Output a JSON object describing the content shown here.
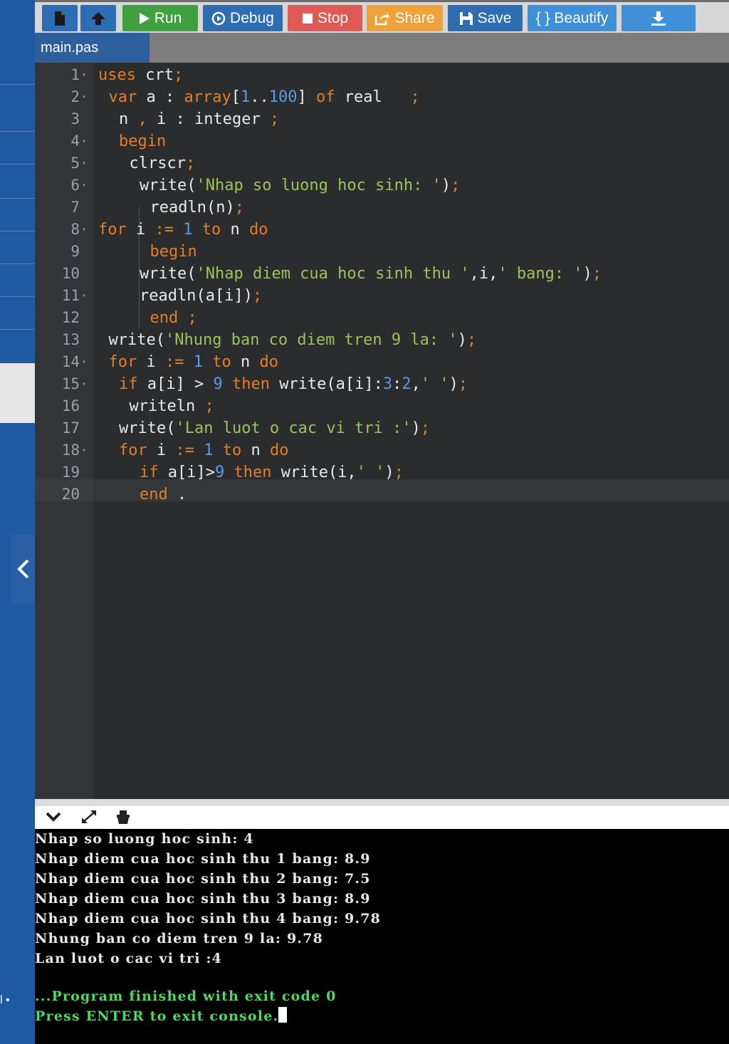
{
  "toolbar": {
    "buttons": [
      {
        "label": "",
        "icon": "new-file-icon",
        "color": "#2c6db5"
      },
      {
        "label": "",
        "icon": "upload-icon",
        "color": "#2c6db5"
      },
      {
        "label": "Run",
        "icon": "play-icon",
        "color": "#3fa03f"
      },
      {
        "label": "Debug",
        "icon": "debug-icon",
        "color": "#2f6db3"
      },
      {
        "label": "Stop",
        "icon": "stop-icon",
        "color": "#e05a55"
      },
      {
        "label": "Share",
        "icon": "share-icon",
        "color": "#f0a23a"
      },
      {
        "label": "Save",
        "icon": "save-icon",
        "color": "#2f6db3"
      },
      {
        "label": "{ } Beautify",
        "icon": "",
        "color": "#3f8fd9"
      },
      {
        "label": "",
        "icon": "download-icon",
        "color": "#3f8fd9"
      }
    ]
  },
  "tab": {
    "filename": "main.pas"
  },
  "editor": {
    "active_line": 17,
    "lines": [
      {
        "n": "1",
        "fold": true
      },
      {
        "n": "2",
        "fold": true
      },
      {
        "n": "3",
        "fold": false
      },
      {
        "n": "4",
        "fold": true
      },
      {
        "n": "5",
        "fold": true
      },
      {
        "n": "6",
        "fold": true
      },
      {
        "n": "7",
        "fold": false
      },
      {
        "n": "8",
        "fold": true
      },
      {
        "n": "9",
        "fold": false
      },
      {
        "n": "10",
        "fold": false
      },
      {
        "n": "11",
        "fold": true
      },
      {
        "n": "12",
        "fold": false
      },
      {
        "n": "13",
        "fold": false
      },
      {
        "n": "14",
        "fold": true
      },
      {
        "n": "15",
        "fold": true
      },
      {
        "n": "16",
        "fold": false
      },
      {
        "n": "17",
        "fold": false
      },
      {
        "n": "18",
        "fold": true
      },
      {
        "n": "19",
        "fold": false
      },
      {
        "n": "20",
        "fold": false
      }
    ],
    "code": {
      "l1": [
        "uses",
        " crt",
        ";"
      ],
      "l2": [
        "var",
        " a : ",
        "array",
        "[",
        "1",
        "..",
        "100",
        "] ",
        "of",
        " real   ",
        ";"
      ],
      "l3": [
        "n ",
        ",",
        " i : integer ",
        ";"
      ],
      "l4": [
        "begin"
      ],
      "l5": [
        "clrscr",
        ";"
      ],
      "l6": [
        "write(",
        "'Nhap so luong hoc sinh: '",
        ")",
        ";"
      ],
      "l7": [
        "readln(n)",
        ";"
      ],
      "l8": [
        "for",
        " i ",
        ":=",
        " ",
        "1",
        " ",
        "to",
        " n ",
        "do"
      ],
      "l9": [
        "begin"
      ],
      "l10": [
        "write(",
        "'Nhap diem cua hoc sinh thu '",
        ",i,",
        "' bang: '",
        ")",
        ";"
      ],
      "l11": [
        "readln(a[i])",
        ";"
      ],
      "l12": [
        "end",
        " ",
        ";"
      ],
      "l13": [
        "write(",
        "'Nhung ban co diem tren 9 la: '",
        ")",
        ";"
      ],
      "l14": [
        "for",
        " i ",
        ":=",
        " ",
        "1",
        " ",
        "to",
        " n ",
        "do"
      ],
      "l15": [
        "if",
        " a[i] > ",
        "9",
        " ",
        "then",
        " write(a[i]:",
        "3",
        ":",
        "2",
        ",",
        "' '",
        ")",
        ";"
      ],
      "l16": [
        "writeln ",
        ";"
      ],
      "l17": [
        "write(",
        "'Lan luot o cac vi tri :'",
        ")",
        ";"
      ],
      "l18": [
        "for",
        " i ",
        ":=",
        " ",
        "1",
        " ",
        "to",
        " n ",
        "do"
      ],
      "l19": [
        "if",
        " a[i]>",
        "9",
        " ",
        "then",
        " write(i,",
        "' '",
        ")",
        ";"
      ],
      "l20": [
        "end",
        " ."
      ]
    }
  },
  "terminal": {
    "output": [
      "Nhap so luong hoc sinh: 4",
      "Nhap diem cua hoc sinh thu 1 bang: 8.9",
      "Nhap diem cua hoc sinh thu 2 bang: 7.5",
      "Nhap diem cua hoc sinh thu 3 bang: 8.9",
      "Nhap diem cua hoc sinh thu 4 bang: 9.78",
      "Nhung ban co diem tren 9 la: 9.78",
      "Lan luot o cac vi tri :4"
    ],
    "finished": "...Program finished with exit code 0",
    "press_enter": "Press ENTER to exit console."
  },
  "sidebar": {
    "footer_text": "l •"
  }
}
